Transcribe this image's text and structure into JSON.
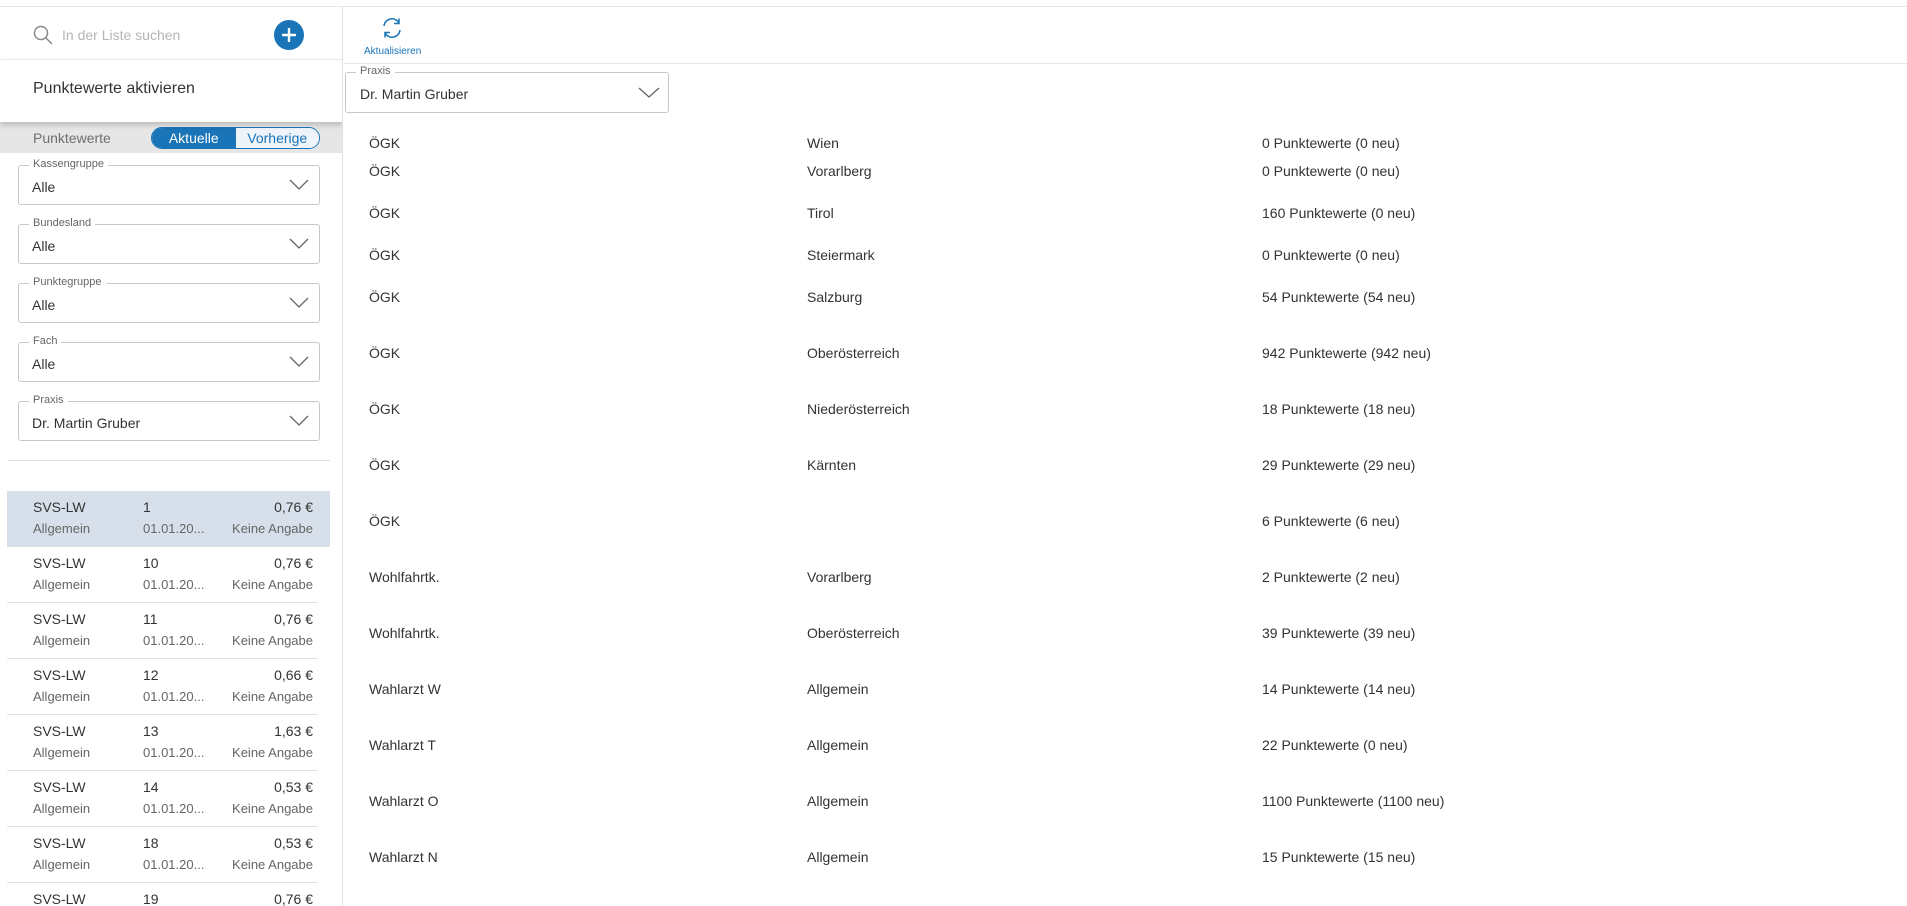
{
  "search": {
    "placeholder": "In der Liste suchen",
    "icon": "search-icon",
    "add_icon": "plus-circle-icon"
  },
  "activate_label": "Punktewerte aktivieren",
  "toggle": {
    "label": "Punktewerte",
    "options": [
      "Aktuelle",
      "Vorherige"
    ],
    "selected": "Aktuelle"
  },
  "filters": [
    {
      "label": "Kassengruppe",
      "value": "Alle"
    },
    {
      "label": "Bundesland",
      "value": "Alle"
    },
    {
      "label": "Punktegruppe",
      "value": "Alle"
    },
    {
      "label": "Fach",
      "value": "Alle"
    },
    {
      "label": "Praxis",
      "value": "Dr. Martin Gruber"
    }
  ],
  "list_items": [
    {
      "kasse": "SVS-LW",
      "nr": "1",
      "value": "0,76 €",
      "group": "Allgemein",
      "date": "01.01.20...",
      "info": "Keine Angabe",
      "selected": true
    },
    {
      "kasse": "SVS-LW",
      "nr": "10",
      "value": "0,76 €",
      "group": "Allgemein",
      "date": "01.01.20...",
      "info": "Keine Angabe"
    },
    {
      "kasse": "SVS-LW",
      "nr": "11",
      "value": "0,76 €",
      "group": "Allgemein",
      "date": "01.01.20...",
      "info": "Keine Angabe"
    },
    {
      "kasse": "SVS-LW",
      "nr": "12",
      "value": "0,66 €",
      "group": "Allgemein",
      "date": "01.01.20...",
      "info": "Keine Angabe"
    },
    {
      "kasse": "SVS-LW",
      "nr": "13",
      "value": "1,63 €",
      "group": "Allgemein",
      "date": "01.01.20...",
      "info": "Keine Angabe"
    },
    {
      "kasse": "SVS-LW",
      "nr": "14",
      "value": "0,53 €",
      "group": "Allgemein",
      "date": "01.01.20...",
      "info": "Keine Angabe"
    },
    {
      "kasse": "SVS-LW",
      "nr": "18",
      "value": "0,53 €",
      "group": "Allgemein",
      "date": "01.01.20...",
      "info": "Keine Angabe"
    },
    {
      "kasse": "SVS-LW",
      "nr": "19",
      "value": "0,76 €",
      "group": "",
      "date": "",
      "info": ""
    }
  ],
  "toolbar": {
    "refresh_label": "Aktualisieren",
    "refresh_icon": "refresh-icon"
  },
  "praxis_select": {
    "label": "Praxis",
    "value": "Dr. Martin Gruber"
  },
  "import_rows": [
    {
      "kasse": "ÖGK",
      "region": "Wien",
      "count": "0 Punktewerte (0 neu)"
    },
    {
      "kasse": "ÖGK",
      "region": "Vorarlberg",
      "count": "0 Punktewerte (0 neu)"
    },
    {
      "kasse": "ÖGK",
      "region": "Tirol",
      "count": "160 Punktewerte (0 neu)"
    },
    {
      "kasse": "ÖGK",
      "region": "Steiermark",
      "count": "0 Punktewerte (0 neu)"
    },
    {
      "kasse": "ÖGK",
      "region": "Salzburg",
      "count": "54 Punktewerte (54 neu)"
    },
    {
      "kasse": "ÖGK",
      "region": "Oberösterreich",
      "count": "942 Punktewerte (942 neu)"
    },
    {
      "kasse": "ÖGK",
      "region": "Niederösterreich",
      "count": "18 Punktewerte (18 neu)"
    },
    {
      "kasse": "ÖGK",
      "region": "Kärnten",
      "count": "29 Punktewerte (29 neu)"
    },
    {
      "kasse": "ÖGK",
      "region": "",
      "count": "6 Punktewerte (6 neu)"
    },
    {
      "kasse": "Wohlfahrtk.",
      "region": "Vorarlberg",
      "count": "2 Punktewerte (2 neu)"
    },
    {
      "kasse": "Wohlfahrtk.",
      "region": "Oberösterreich",
      "count": "39 Punktewerte (39 neu)"
    },
    {
      "kasse": "Wahlarzt W",
      "region": "Allgemein",
      "count": "14 Punktewerte (14 neu)"
    },
    {
      "kasse": "Wahlarzt T",
      "region": "Allgemein",
      "count": "22 Punktewerte (0 neu)"
    },
    {
      "kasse": "Wahlarzt O",
      "region": "Allgemein",
      "count": "1100 Punktewerte (1100 neu)"
    },
    {
      "kasse": "Wahlarzt N",
      "region": "Allgemein",
      "count": "15 Punktewerte (15 neu)"
    }
  ],
  "colors": {
    "accent": "#1a74b8",
    "selected_row": "#d7e0ea",
    "toggle_bg": "#e6e6e6"
  }
}
